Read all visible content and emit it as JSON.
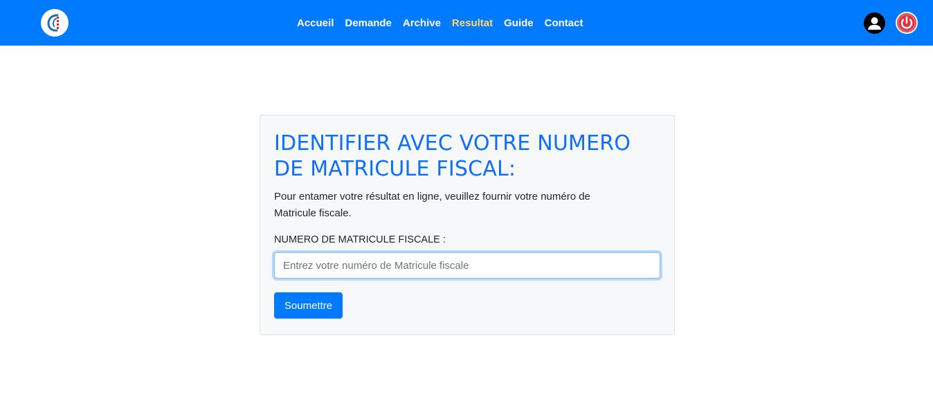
{
  "nav": {
    "logo_icon": "company-logo-icon",
    "links": [
      {
        "label": "Accueil",
        "active": false
      },
      {
        "label": "Demande",
        "active": false
      },
      {
        "label": "Archive",
        "active": false
      },
      {
        "label": "Resultat",
        "active": true
      },
      {
        "label": "Guide",
        "active": false
      },
      {
        "label": "Contact",
        "active": false
      }
    ],
    "user_icon": "user-profile-icon",
    "logout_icon": "power-icon"
  },
  "form": {
    "title": "IDENTIFIER AVEC VOTRE NUMERO DE MATRICULE FISCAL:",
    "description": "Pour entamer votre résultat en ligne, veuillez fournir votre numéro de Matricule fiscale.",
    "field_label": "NUMERO DE MATRICULE FISCALE :",
    "field_value": "",
    "field_placeholder": "Entrez votre numéro de Matricule fiscale",
    "submit_label": "Soumettre"
  },
  "colors": {
    "primary": "#007bff",
    "active_link": "#ffd966",
    "title": "#0d6efd",
    "logout": "#dc3545"
  }
}
